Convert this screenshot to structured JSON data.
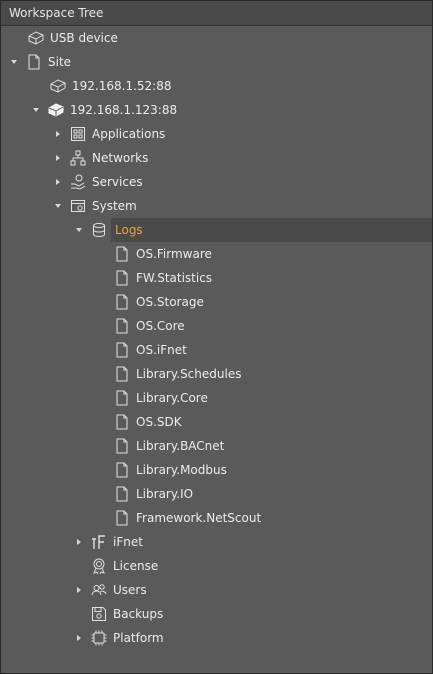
{
  "panel": {
    "title": "Workspace Tree"
  },
  "colors": {
    "background": "#5a5a5a",
    "header": "#4a4a4a",
    "selected_text": "#e8a33a",
    "selected_bg": "#4a4a4a"
  },
  "tree": {
    "usb_device": "USB device",
    "site": "Site",
    "device1": "192.168.1.52:88",
    "device2": "192.168.1.123:88",
    "applications": "Applications",
    "networks": "Networks",
    "services": "Services",
    "system": "System",
    "logs": "Logs",
    "log_items": [
      "OS.Firmware",
      "FW.Statistics",
      "OS.Storage",
      "OS.Core",
      "OS.iFnet",
      "Library.Schedules",
      "Library.Core",
      "OS.SDK",
      "Library.BACnet",
      "Library.Modbus",
      "Library.IO",
      "Framework.NetScout"
    ],
    "ifnet": "iFnet",
    "license": "License",
    "users": "Users",
    "backups": "Backups",
    "platform": "Platform"
  }
}
